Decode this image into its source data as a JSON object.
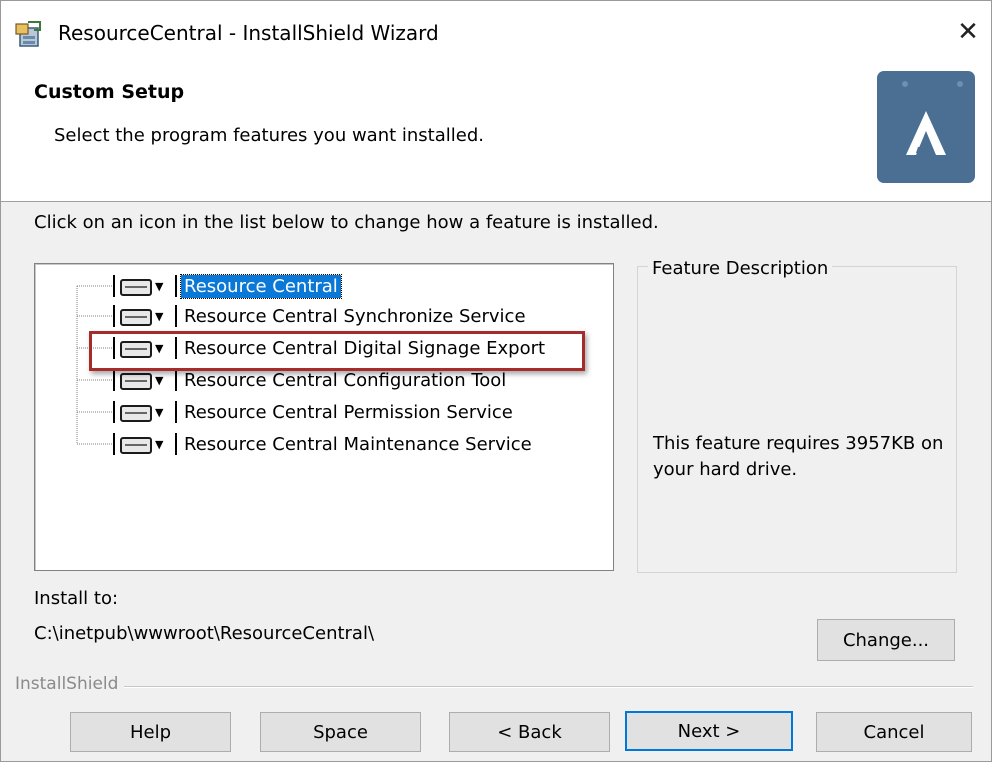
{
  "window": {
    "title": "ResourceCentral - InstallShield Wizard",
    "close_glyph": "✕",
    "app_icon": "installer-icon"
  },
  "header": {
    "title": "Custom Setup",
    "subtitle": "Select the program features you want installed.",
    "logo_icon": "resource-central-logo",
    "logo_color": "#4a6f93"
  },
  "instruction": "Click on an icon in the list below to change how a feature is installed.",
  "features": [
    {
      "label": "Resource Central",
      "selected": true
    },
    {
      "label": "Resource Central Synchronize Service",
      "selected": false
    },
    {
      "label": "Resource Central Digital Signage Export",
      "selected": false,
      "highlighted": true
    },
    {
      "label": "Resource Central Configuration Tool",
      "selected": false
    },
    {
      "label": "Resource Central Permission Service",
      "selected": false
    },
    {
      "label": "Resource Central Maintenance Service",
      "selected": false
    }
  ],
  "description": {
    "legend": "Feature Description",
    "text": "This feature requires 3957KB on your hard drive."
  },
  "install": {
    "label": "Install to:",
    "path": "C:\\inetpub\\wwwroot\\ResourceCentral\\",
    "change_button": "Change..."
  },
  "footer": {
    "group_label": "InstallShield",
    "buttons": {
      "help": "Help",
      "space": "Space",
      "back": "< Back",
      "next": "Next >",
      "cancel": "Cancel"
    }
  },
  "colors": {
    "selection": "#0a78d7",
    "highlight_border": "#a62b2b",
    "primary_border": "#0078d7"
  }
}
